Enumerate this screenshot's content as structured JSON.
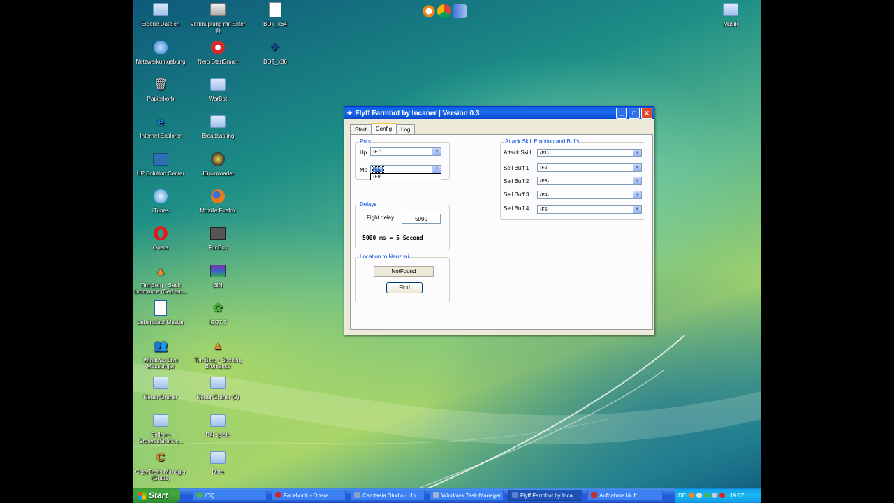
{
  "desktop": {
    "icons": [
      {
        "label": "Eigene Dateien",
        "icon": "my-documents-folder-icon"
      },
      {
        "label": "Verknüpfung mit Exter (I)",
        "icon": "drive-shortcut-icon"
      },
      {
        "label": "BOT_x64",
        "icon": "file-icon"
      },
      {
        "label": "Musik",
        "icon": "folder-icon"
      },
      {
        "label": "Netzwerkumgebung",
        "icon": "network-icon"
      },
      {
        "label": "Nero StartSmart",
        "icon": "nero-icon"
      },
      {
        "label": "BOT_x86",
        "icon": "bot-icon"
      },
      {
        "label": "Papierkorb",
        "icon": "recycle-bin-icon"
      },
      {
        "label": "WarBot",
        "icon": "folder-icon"
      },
      {
        "label": "Internet Explorer",
        "icon": "internet-explorer-icon"
      },
      {
        "label": "Broadcasting",
        "icon": "folder-icon"
      },
      {
        "label": "HP Solution Center",
        "icon": "hp-icon"
      },
      {
        "label": "JDownloader",
        "icon": "jdownloader-icon"
      },
      {
        "label": "iTunes",
        "icon": "itunes-icon"
      },
      {
        "label": "Mozilla Firefox",
        "icon": "firefox-icon"
      },
      {
        "label": "Opera",
        "icon": "opera-icon"
      },
      {
        "label": "FunBox",
        "icon": "funbox-icon"
      },
      {
        "label": "Tim Berg - Seek bromance (Ced tec...",
        "icon": "vlc-icon"
      },
      {
        "label": "BIN",
        "icon": "winrar-icon"
      },
      {
        "label": "Lebenslauf-Muster",
        "icon": "word-document-icon"
      },
      {
        "label": "ICQ7.7",
        "icon": "icq-icon"
      },
      {
        "label": "Windows Live Messenger",
        "icon": "messenger-icon"
      },
      {
        "label": "Tim Berg - Seeking Bromance",
        "icon": "vlc-icon"
      },
      {
        "label": "Neuer Ordner",
        "icon": "folder-icon"
      },
      {
        "label": "Neuer Ordner (2)",
        "icon": "folder-icon"
      },
      {
        "label": "Sollen's GroovesShark.c...",
        "icon": "folder-icon"
      },
      {
        "label": "R4i spiele",
        "icon": "folder-icon"
      },
      {
        "label": "CopyTrans Manager (Gratis)",
        "icon": "copytrans-icon"
      },
      {
        "label": "Data",
        "icon": "folder-icon"
      }
    ],
    "top_icons": [
      "copytrans-icon",
      "chrome-icon",
      "finder-icon"
    ]
  },
  "window": {
    "title": "Flyff Farmbot by Incaner | Version 0.3",
    "tabs": [
      "Start",
      "Config",
      "Log"
    ],
    "active_tab": "Config",
    "pots": {
      "legend": "Pots",
      "hp_label": "Hp",
      "hp_value": "{F7}",
      "mp_label": "Mp",
      "mp_value": "{F8}",
      "mp_dropdown_option": "{F9}"
    },
    "delays": {
      "legend": "Delays",
      "fight_delay_label": "Fight delay",
      "fight_delay_value": "5000",
      "info": "5000 ms = 5 Second"
    },
    "location": {
      "legend": "Location to Neuz.ini",
      "status": "NotFound",
      "find_button": "Find"
    },
    "attack": {
      "legend": "Attack Skill Emotion and Buffs",
      "rows": [
        {
          "label": "Attack Skill",
          "value": "{F1}"
        },
        {
          "label": "Sell Buff 1",
          "value": "{F2}"
        },
        {
          "label": "Sell Buff 2",
          "value": "{F3}"
        },
        {
          "label": "Sell Buff 3",
          "value": "{F4}"
        },
        {
          "label": "Sell Buff 4",
          "value": "{F5}"
        }
      ]
    }
  },
  "taskbar": {
    "start_label": "Start",
    "tasks": [
      {
        "label": "ICQ",
        "color": "#4caf50"
      },
      {
        "label": "Facebook - Opera",
        "color": "#e02020"
      },
      {
        "label": "Camtasia Studio - Un...",
        "color": "#8aa0c8"
      },
      {
        "label": "Windows Task-Manager",
        "color": "#9fb3d9"
      },
      {
        "label": "Flyff Farmbot by Inca...",
        "color": "#5b7fd8"
      },
      {
        "label": "Aufnahme läuft...",
        "color": "#c03030"
      }
    ],
    "active_task": 4,
    "tray_lang": "DE",
    "clock": "19:07"
  }
}
